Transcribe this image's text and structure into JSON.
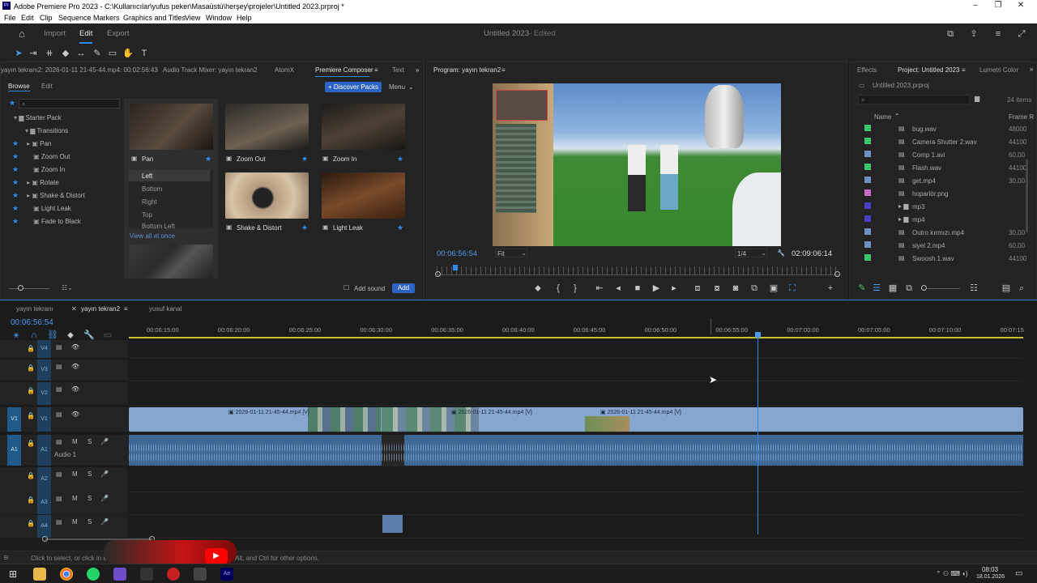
{
  "window": {
    "title": "Adobe Premiere Pro 2023 - C:\\Kullanıcılar\\yufus peker\\Masaüstü\\herşey\\projeler\\Untitled 2023.prproj *"
  },
  "menu": [
    "File",
    "Edit",
    "Clip",
    "Sequence",
    "Markers",
    "Graphics and Titles",
    "View",
    "Window",
    "Help"
  ],
  "header": {
    "tabs": [
      "Import",
      "Edit",
      "Export"
    ],
    "project_title": "Untitled 2023",
    "status": "Edited"
  },
  "source_panel": {
    "tabs": [
      "yayın tekranı2: 2026-01-11 21-45-44.mp4: 00:02:56:43",
      "Audio Track Mixer: yayın tekran2",
      "AtomX",
      "Premiere Composer",
      "Text"
    ],
    "subtabs": [
      "Browse",
      "Edit"
    ],
    "discover": "+ Discover Packs",
    "menu": "Menu",
    "tree": [
      "Starter Pack",
      "Transitions",
      "Pan",
      "Zoom Out",
      "Zoom In",
      "Rotate",
      "Shake & Distort",
      "Light Leak",
      "Fade to Black"
    ],
    "thumbs": [
      "Pan",
      "Zoom Out",
      "Zoom In",
      "Shake & Distort",
      "Light Leak"
    ],
    "pan_options": [
      "Left",
      "Bottom",
      "Right",
      "Top",
      "Bottom Left"
    ],
    "view_all": "View all at once",
    "add_sound": "Add sound",
    "add": "Add"
  },
  "program": {
    "tab": "Program: yayın tekran2",
    "timecode": "00:06:56:54",
    "fit": "Fit",
    "ratio": "1/4",
    "duration": "02:09:06:14"
  },
  "project_panel": {
    "tabs": [
      "Effects",
      "Project: Untitled 2023",
      "Lumetri Color"
    ],
    "file": "Untitled 2023.prproj",
    "count": "24 items",
    "col_name": "Name",
    "col_rate": "Frame R",
    "items": [
      {
        "name": "bug.wav",
        "rate": "48000",
        "color": "#3ec46d"
      },
      {
        "name": "Camera Shutter 2.wav",
        "rate": "44100",
        "color": "#3ec46d"
      },
      {
        "name": "Comp 1.avi",
        "rate": "60,00",
        "color": "#6f8ec4"
      },
      {
        "name": "Flash.wav",
        "rate": "44100",
        "color": "#3ec46d"
      },
      {
        "name": "get.mp4",
        "rate": "30,00",
        "color": "#6f8ec4"
      },
      {
        "name": "hoparlör.png",
        "rate": "",
        "color": "#c86bc8"
      },
      {
        "name": "mp3",
        "rate": "",
        "color": "#4a3fc9"
      },
      {
        "name": "mp4",
        "rate": "",
        "color": "#4a3fc9"
      },
      {
        "name": "Outro kırmızı.mp4",
        "rate": "30,00",
        "color": "#6f8ec4"
      },
      {
        "name": "siyel 2.mp4",
        "rate": "60,00",
        "color": "#6f8ec4"
      },
      {
        "name": "Swoosh 1.wav",
        "rate": "44100",
        "color": "#3ec46d"
      }
    ]
  },
  "timeline": {
    "tabs": [
      "yayın tekranı",
      "yayın tekran2",
      "yusuf kanal"
    ],
    "timecode": "00:06:56:54",
    "ticks": [
      "00:06:15:00",
      "00:06:20:00",
      "00:06:25:00",
      "00:06:30:00",
      "00:06:35:00",
      "00:06:40:00",
      "00:06:45:00",
      "00:06:50:00",
      "00:06:55:00",
      "00:07:00:00",
      "00:07:05:00",
      "00:07:10:00",
      "00:07:15"
    ],
    "tracks": [
      "V4",
      "V3",
      "V2",
      "V1",
      "A1",
      "A2",
      "A3",
      "A4"
    ],
    "audio1": "Audio 1",
    "clips": [
      "2026-01-11 21-45-44.mp4 [V]",
      "2026-01-11 21-45-44.mp4 [V]",
      "2026-01-11 21-45-44.mp4 [V]"
    ]
  },
  "status": "Click to select, or click in e",
  "status2": "Alt, and Ctrl for other options.",
  "clock": {
    "time": "08:03",
    "date": "18.01.2026"
  }
}
